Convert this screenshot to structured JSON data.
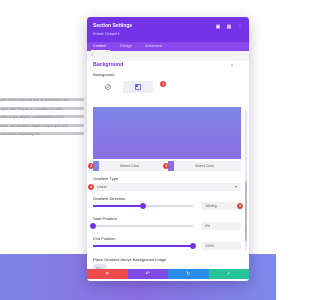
{
  "background_page": {
    "lines": [
      "pler. Donec placerat erat ac fermentum acc",
      "ngue odio tempus ut. Curabitur ac enim",
      "vitae augue aliquet, condimentum est ut",
      "enim, nec faucibus sapien neque quis sem.",
      "onsectetur adipiscing elit."
    ]
  },
  "modal": {
    "title": "Section Settings",
    "preset": "Preset: Default ▾",
    "header_icons": [
      "window-icon",
      "grid-icon",
      "more-icon"
    ],
    "tabs": [
      {
        "label": "Content",
        "active": true
      },
      {
        "label": "Design",
        "active": false
      },
      {
        "label": "Advanced",
        "active": false
      }
    ],
    "section": {
      "title": "Background",
      "background_label": "Background",
      "type_tabs": [
        "none",
        "color",
        "gradient",
        "image",
        "video",
        "pattern"
      ],
      "active_type_index": 1,
      "gradient_colors": {
        "start": "#7e85e6",
        "end": "#8b6fe3"
      },
      "color_buttons": [
        {
          "label": "Select Color",
          "swatch": "#7e85e6"
        },
        {
          "label": "Select Color",
          "swatch": "#8b6fe3"
        }
      ],
      "gradient_type_label": "Gradient Type",
      "gradient_type_value": "Linear",
      "gradient_direction_label": "Gradient Direction",
      "gradient_direction_value": "180deg",
      "gradient_direction_fraction": 0.5,
      "start_position_label": "Start Position",
      "start_position_value": "0%",
      "start_position_fraction": 0.0,
      "end_position_label": "End Position",
      "end_position_value": "100%",
      "end_position_fraction": 1.0,
      "place_gradient_label": "Place Gradient Above Background Image",
      "place_gradient_value": "NO"
    },
    "markers": [
      "1",
      "2",
      "3",
      "4",
      "5"
    ],
    "footer_buttons": [
      {
        "name": "cancel",
        "icon": "✕",
        "color": "#ef4b4b"
      },
      {
        "name": "undo",
        "icon": "↶",
        "color": "#7e4be5"
      },
      {
        "name": "redo",
        "icon": "↻",
        "color": "#2b8be5"
      },
      {
        "name": "save",
        "icon": "✓",
        "color": "#27c499"
      }
    ]
  }
}
